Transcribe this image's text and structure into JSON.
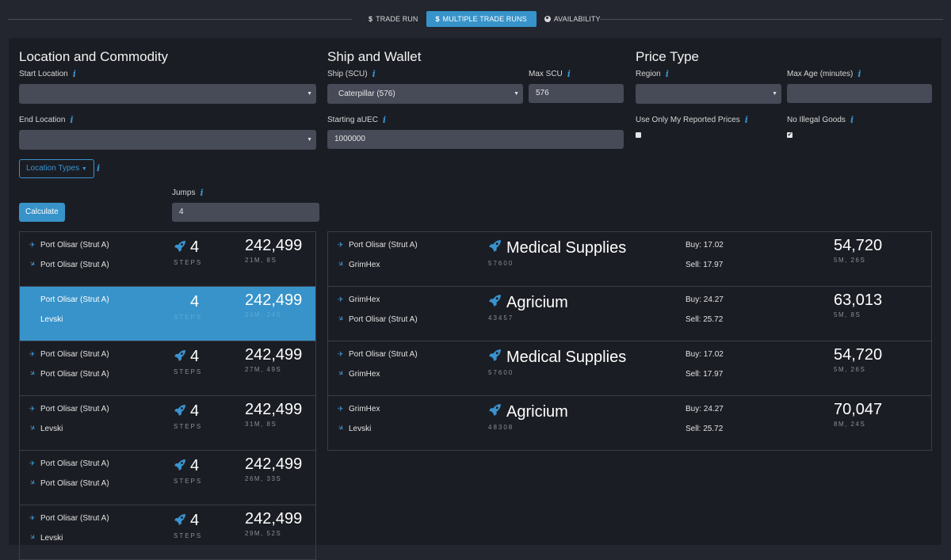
{
  "nav": {
    "tabs": [
      {
        "label": "TRADE RUN",
        "icon": "dollar-icon",
        "glyph": "$",
        "active": false
      },
      {
        "label": "MULTIPLE TRADE RUNS",
        "icon": "dollar-icon",
        "glyph": "$",
        "active": true
      },
      {
        "label": "AVAILABILITY",
        "icon": "globe-icon",
        "glyph": "",
        "active": false
      }
    ]
  },
  "location": {
    "title": "Location and Commodity",
    "start_label": "Start Location",
    "start_value": "",
    "end_label": "End Location",
    "end_value": "",
    "location_types_label": "Location Types",
    "jumps_label": "Jumps",
    "jumps_value": "4",
    "calculate_label": "Calculate"
  },
  "ship": {
    "title": "Ship and Wallet",
    "ship_label": "Ship (SCU)",
    "ship_value": "Caterpillar (576)",
    "max_scu_label": "Max SCU",
    "max_scu_value": "576",
    "auec_label": "Starting aUEC",
    "auec_value": "1000000"
  },
  "price": {
    "title": "Price Type",
    "region_label": "Region",
    "region_value": "",
    "max_age_label": "Max Age (minutes)",
    "max_age_value": "",
    "reported_label": "Use Only My Reported Prices",
    "reported_checked": false,
    "illegal_label": "No Illegal Goods",
    "illegal_checked": true
  },
  "icons": {
    "info": "i",
    "caret": "▼",
    "check": "✔",
    "departure": "✈",
    "arrival": "✈",
    "rocket": "🚀"
  },
  "routes": [
    {
      "from": "Port Olisar (Strut A)",
      "to": "Port Olisar (Strut A)",
      "steps": "4",
      "steps_label": "STEPS",
      "profit": "242,499",
      "duration": "21M, 8S",
      "selected": false
    },
    {
      "from": "Port Olisar (Strut A)",
      "to": "Levski",
      "steps": "4",
      "steps_label": "STEPS",
      "profit": "242,499",
      "duration": "24M, 24S",
      "selected": true
    },
    {
      "from": "Port Olisar (Strut A)",
      "to": "Port Olisar (Strut A)",
      "steps": "4",
      "steps_label": "STEPS",
      "profit": "242,499",
      "duration": "27M, 49S",
      "selected": false
    },
    {
      "from": "Port Olisar (Strut A)",
      "to": "Levski",
      "steps": "4",
      "steps_label": "STEPS",
      "profit": "242,499",
      "duration": "31M, 8S",
      "selected": false
    },
    {
      "from": "Port Olisar (Strut A)",
      "to": "Port Olisar (Strut A)",
      "steps": "4",
      "steps_label": "STEPS",
      "profit": "242,499",
      "duration": "26M, 33S",
      "selected": false
    },
    {
      "from": "Port Olisar (Strut A)",
      "to": "Levski",
      "steps": "4",
      "steps_label": "STEPS",
      "profit": "242,499",
      "duration": "29M, 52S",
      "selected": false
    }
  ],
  "steps_detail": [
    {
      "from": "Port Olisar (Strut A)",
      "to": "GrimHex",
      "commodity": "Medical Supplies",
      "scu_cost": "57600",
      "buy": "Buy: 17.02",
      "sell": "Sell: 17.97",
      "profit": "54,720",
      "duration": "5M, 26S"
    },
    {
      "from": "GrimHex",
      "to": "Port Olisar (Strut A)",
      "commodity": "Agricium",
      "scu_cost": "43457",
      "buy": "Buy: 24.27",
      "sell": "Sell: 25.72",
      "profit": "63,013",
      "duration": "5M, 8S"
    },
    {
      "from": "Port Olisar (Strut A)",
      "to": "GrimHex",
      "commodity": "Medical Supplies",
      "scu_cost": "57600",
      "buy": "Buy: 17.02",
      "sell": "Sell: 17.97",
      "profit": "54,720",
      "duration": "5M, 26S"
    },
    {
      "from": "GrimHex",
      "to": "Levski",
      "commodity": "Agricium",
      "scu_cost": "48308",
      "buy": "Buy: 24.27",
      "sell": "Sell: 25.72",
      "profit": "70,047",
      "duration": "8M, 24S"
    }
  ]
}
